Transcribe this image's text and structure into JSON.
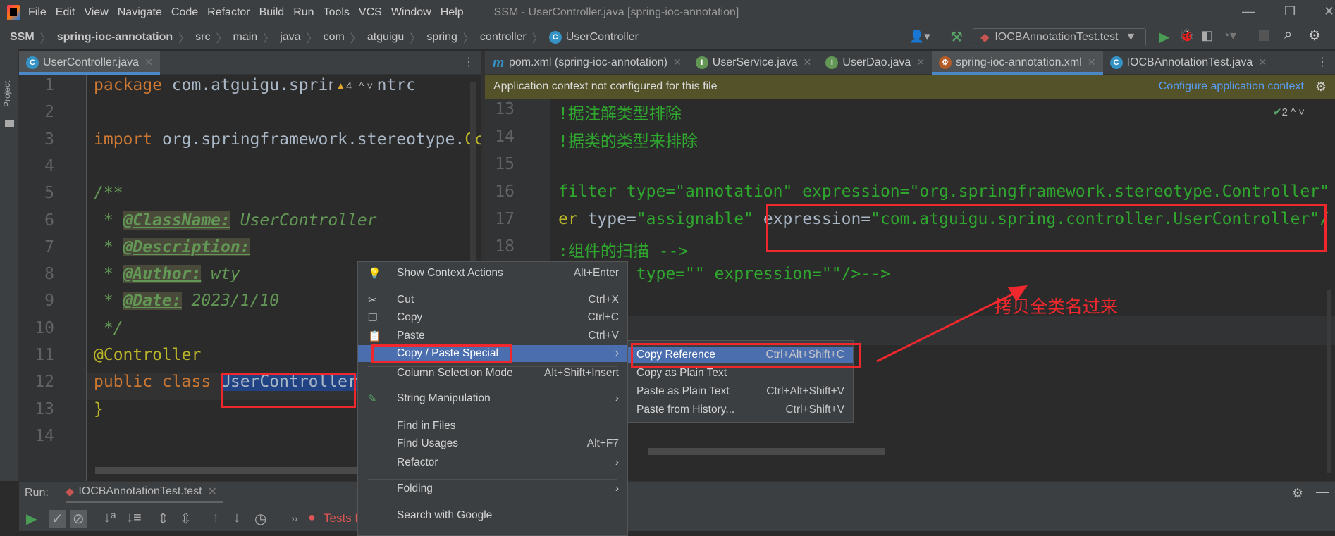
{
  "menubar": {
    "items": [
      "File",
      "Edit",
      "View",
      "Navigate",
      "Code",
      "Refactor",
      "Build",
      "Run",
      "Tools",
      "VCS",
      "Window",
      "Help"
    ],
    "title": "SSM - UserController.java [spring-ioc-annotation]"
  },
  "breadcrumb": [
    "SSM",
    "spring-ioc-annotation",
    "src",
    "main",
    "java",
    "com",
    "atguigu",
    "spring",
    "controller",
    "UserController"
  ],
  "toolbar": {
    "run_config": "IOCBAnnotationTest.test"
  },
  "sidebar": {
    "project_label": "Project"
  },
  "left_editor": {
    "tab": "UserController.java",
    "warnings": "4",
    "line_numbers": [
      "1",
      "2",
      "3",
      "4",
      "5",
      "6",
      "7",
      "8",
      "9",
      "10",
      "11",
      "12",
      "13",
      "14"
    ],
    "lines": [
      [
        [
          "kw",
          "package "
        ],
        [
          "tx",
          "com.atguigu.spring.contrc"
        ]
      ],
      [],
      [
        [
          "kw",
          "import "
        ],
        [
          "tx",
          "org.springframework.stereotype."
        ],
        [
          "an",
          "Cc"
        ]
      ],
      [],
      [
        [
          "cm",
          "/**"
        ]
      ],
      [
        [
          "cm",
          " * "
        ],
        [
          "tag",
          "@ClassName:"
        ],
        [
          "cm",
          " UserController"
        ]
      ],
      [
        [
          "cm",
          " * "
        ],
        [
          "tag",
          "@Description:"
        ]
      ],
      [
        [
          "cm",
          " * "
        ],
        [
          "tag",
          "@Author:"
        ],
        [
          "cm",
          " wty"
        ]
      ],
      [
        [
          "cm",
          " * "
        ],
        [
          "tag",
          "@Date:"
        ],
        [
          "cm",
          " 2023/1/10"
        ]
      ],
      [
        [
          "cm",
          " */"
        ]
      ],
      [
        [
          "an",
          "@Controller"
        ]
      ],
      [
        [
          "kw",
          "public class "
        ],
        [
          "sel",
          "UserController"
        ]
      ],
      [
        [
          "an",
          "}"
        ]
      ],
      []
    ]
  },
  "right_editor": {
    "tabs": [
      {
        "label": "pom.xml (spring-ioc-annotation)",
        "icon": "maven-icon"
      },
      {
        "label": "UserService.java",
        "icon": "interface-icon"
      },
      {
        "label": "UserDao.java",
        "icon": "interface-icon"
      },
      {
        "label": "spring-ioc-annotation.xml",
        "icon": "xml-icon",
        "active": true
      },
      {
        "label": "IOCBAnnotationTest.java",
        "icon": "class-icon"
      }
    ],
    "banner": "Application context not configured for this file",
    "banner_action": "Configure application context",
    "checks": "2",
    "line_numbers": [
      "13",
      "14",
      "15",
      "16",
      "17",
      "18"
    ],
    "lines": [
      [
        [
          "xg",
          "!据注解类型排除"
        ]
      ],
      [
        [
          "xg",
          "!据类的类型来排除"
        ]
      ],
      [],
      [
        [
          "xg",
          "filter type=\"annotation\" expression=\"org.springframework.stereotype.Controller\""
        ]
      ],
      [
        [
          "an",
          "er "
        ],
        [
          "tx",
          "type="
        ],
        [
          "xg",
          "\"assignable\""
        ],
        [
          "tx",
          " expression="
        ],
        [
          "xg",
          "\"com.atguigu.spring.controller.UserController\"/"
        ]
      ],
      [
        [
          "xg",
          ":组件的扫描 -->"
        ]
      ],
      [
        [
          "xg",
          "        type=\"\" expression=\"\"/>-->"
        ]
      ]
    ]
  },
  "context_menu": {
    "items": [
      {
        "label": "Show Context Actions",
        "shortcut": "Alt+Enter",
        "icon": "bulb-icon"
      },
      {
        "label": "Cut",
        "shortcut": "Ctrl+X",
        "icon": "scissors-icon"
      },
      {
        "label": "Copy",
        "shortcut": "Ctrl+C",
        "icon": "copy-icon"
      },
      {
        "label": "Paste",
        "shortcut": "Ctrl+V",
        "icon": "paste-icon"
      },
      {
        "label": "Copy / Paste Special",
        "shortcut": "›",
        "highlighted": true
      },
      {
        "label": "Column Selection Mode",
        "shortcut": "Alt+Shift+Insert"
      },
      {
        "label": "String Manipulation",
        "shortcut": "›",
        "icon": "pencil-icon"
      },
      {
        "label": "Find in Files",
        "shortcut": ""
      },
      {
        "label": "Find Usages",
        "shortcut": "Alt+F7"
      },
      {
        "label": "Refactor",
        "shortcut": "›"
      },
      {
        "label": "Folding",
        "shortcut": "›"
      },
      {
        "label": "Search with Google",
        "shortcut": ""
      }
    ]
  },
  "submenu": {
    "items": [
      {
        "label": "Copy Reference",
        "shortcut": "Ctrl+Alt+Shift+C",
        "highlighted": true
      },
      {
        "label": "Copy as Plain Text",
        "shortcut": ""
      },
      {
        "label": "Paste as Plain Text",
        "shortcut": "Ctrl+Alt+Shift+V"
      },
      {
        "label": "Paste from History...",
        "shortcut": "Ctrl+Shift+V"
      }
    ]
  },
  "annotation": {
    "text": "拷贝全类名过来",
    "color": "#f0282d"
  },
  "run_panel": {
    "label": "Run:",
    "tab": "IOCBAnnotationTest.test",
    "status": "Tests f"
  }
}
